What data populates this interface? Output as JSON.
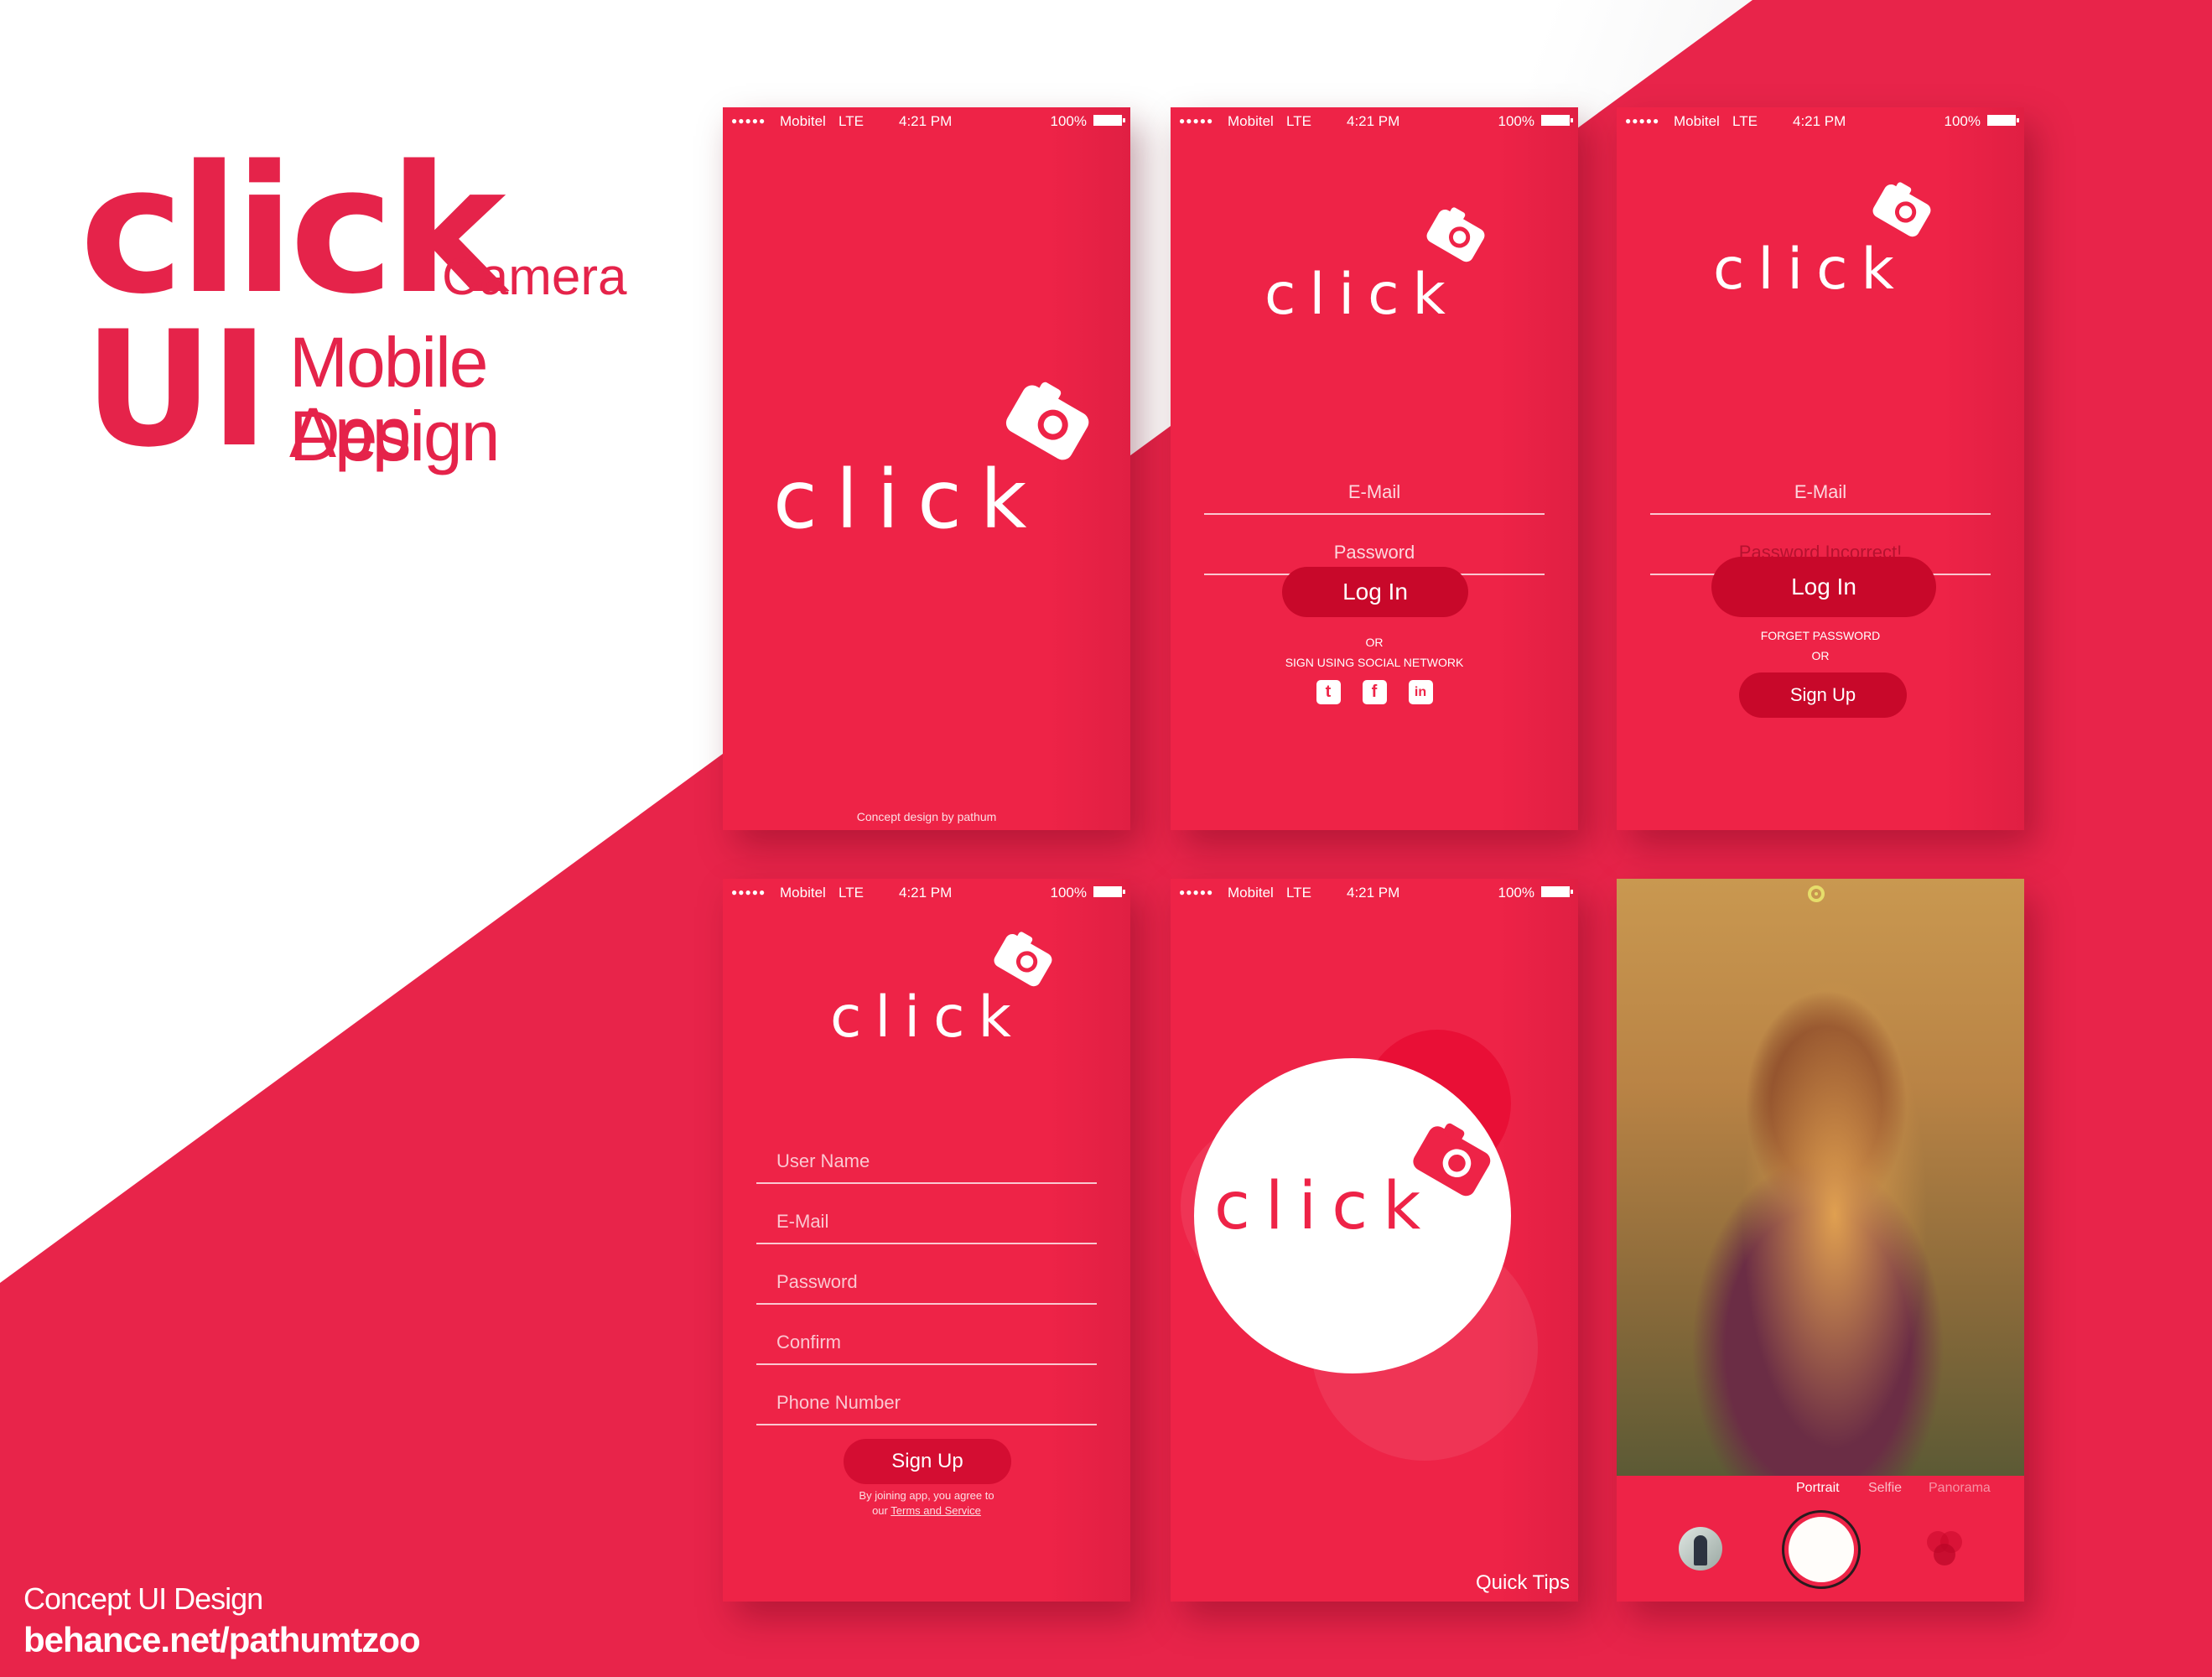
{
  "hero": {
    "brand": "click",
    "subtitle_1": "Camera",
    "prefix": "UI",
    "subtitle_2": "Mobile App",
    "subtitle_3": "Design"
  },
  "credits": {
    "line_1": "Concept UI Design",
    "line_2": "behance.net/pathumtzoo"
  },
  "status_bar": {
    "signal": "●●●●●",
    "carrier": "Mobitel",
    "network": "LTE",
    "time": "4:21 PM",
    "battery": "100%"
  },
  "logo_text": "click",
  "splash": {
    "footer": "Concept design by pathum"
  },
  "login": {
    "email_placeholder": "E-Mail",
    "password_placeholder": "Password",
    "login_button": "Log In",
    "or": "OR",
    "social_text": "SIGN USING SOCIAL NETWORK",
    "social": [
      {
        "name": "twitter-icon",
        "glyph": "t"
      },
      {
        "name": "facebook-icon",
        "glyph": "f"
      },
      {
        "name": "linkedin-icon",
        "glyph": "in"
      }
    ]
  },
  "login_error": {
    "email_placeholder": "E-Mail",
    "password_error": "Password Incorrect!",
    "login_button": "Log In",
    "forget_password": "FORGET PASSWORD",
    "or": "OR",
    "signup_button": "Sign Up"
  },
  "signup": {
    "fields": [
      "User Name",
      "E-Mail",
      "Password",
      "Confirm",
      "Phone Number"
    ],
    "signup_button": "Sign Up",
    "terms_prefix": "By joining app, you agree to",
    "terms_our": "our",
    "terms_link": "Terms and Service"
  },
  "intro": {
    "quick_tips": "Quick Tips"
  },
  "camera": {
    "modes": [
      "Portrait",
      "Selfie",
      "Panorama"
    ],
    "active_mode": "Portrait",
    "colors": {
      "focus_ring": "#e6dd6a",
      "accent": "#ee2347"
    }
  },
  "colors": {
    "brand_red": "#ee2347",
    "button_red": "#c8082a",
    "background_red": "#e8244a"
  }
}
